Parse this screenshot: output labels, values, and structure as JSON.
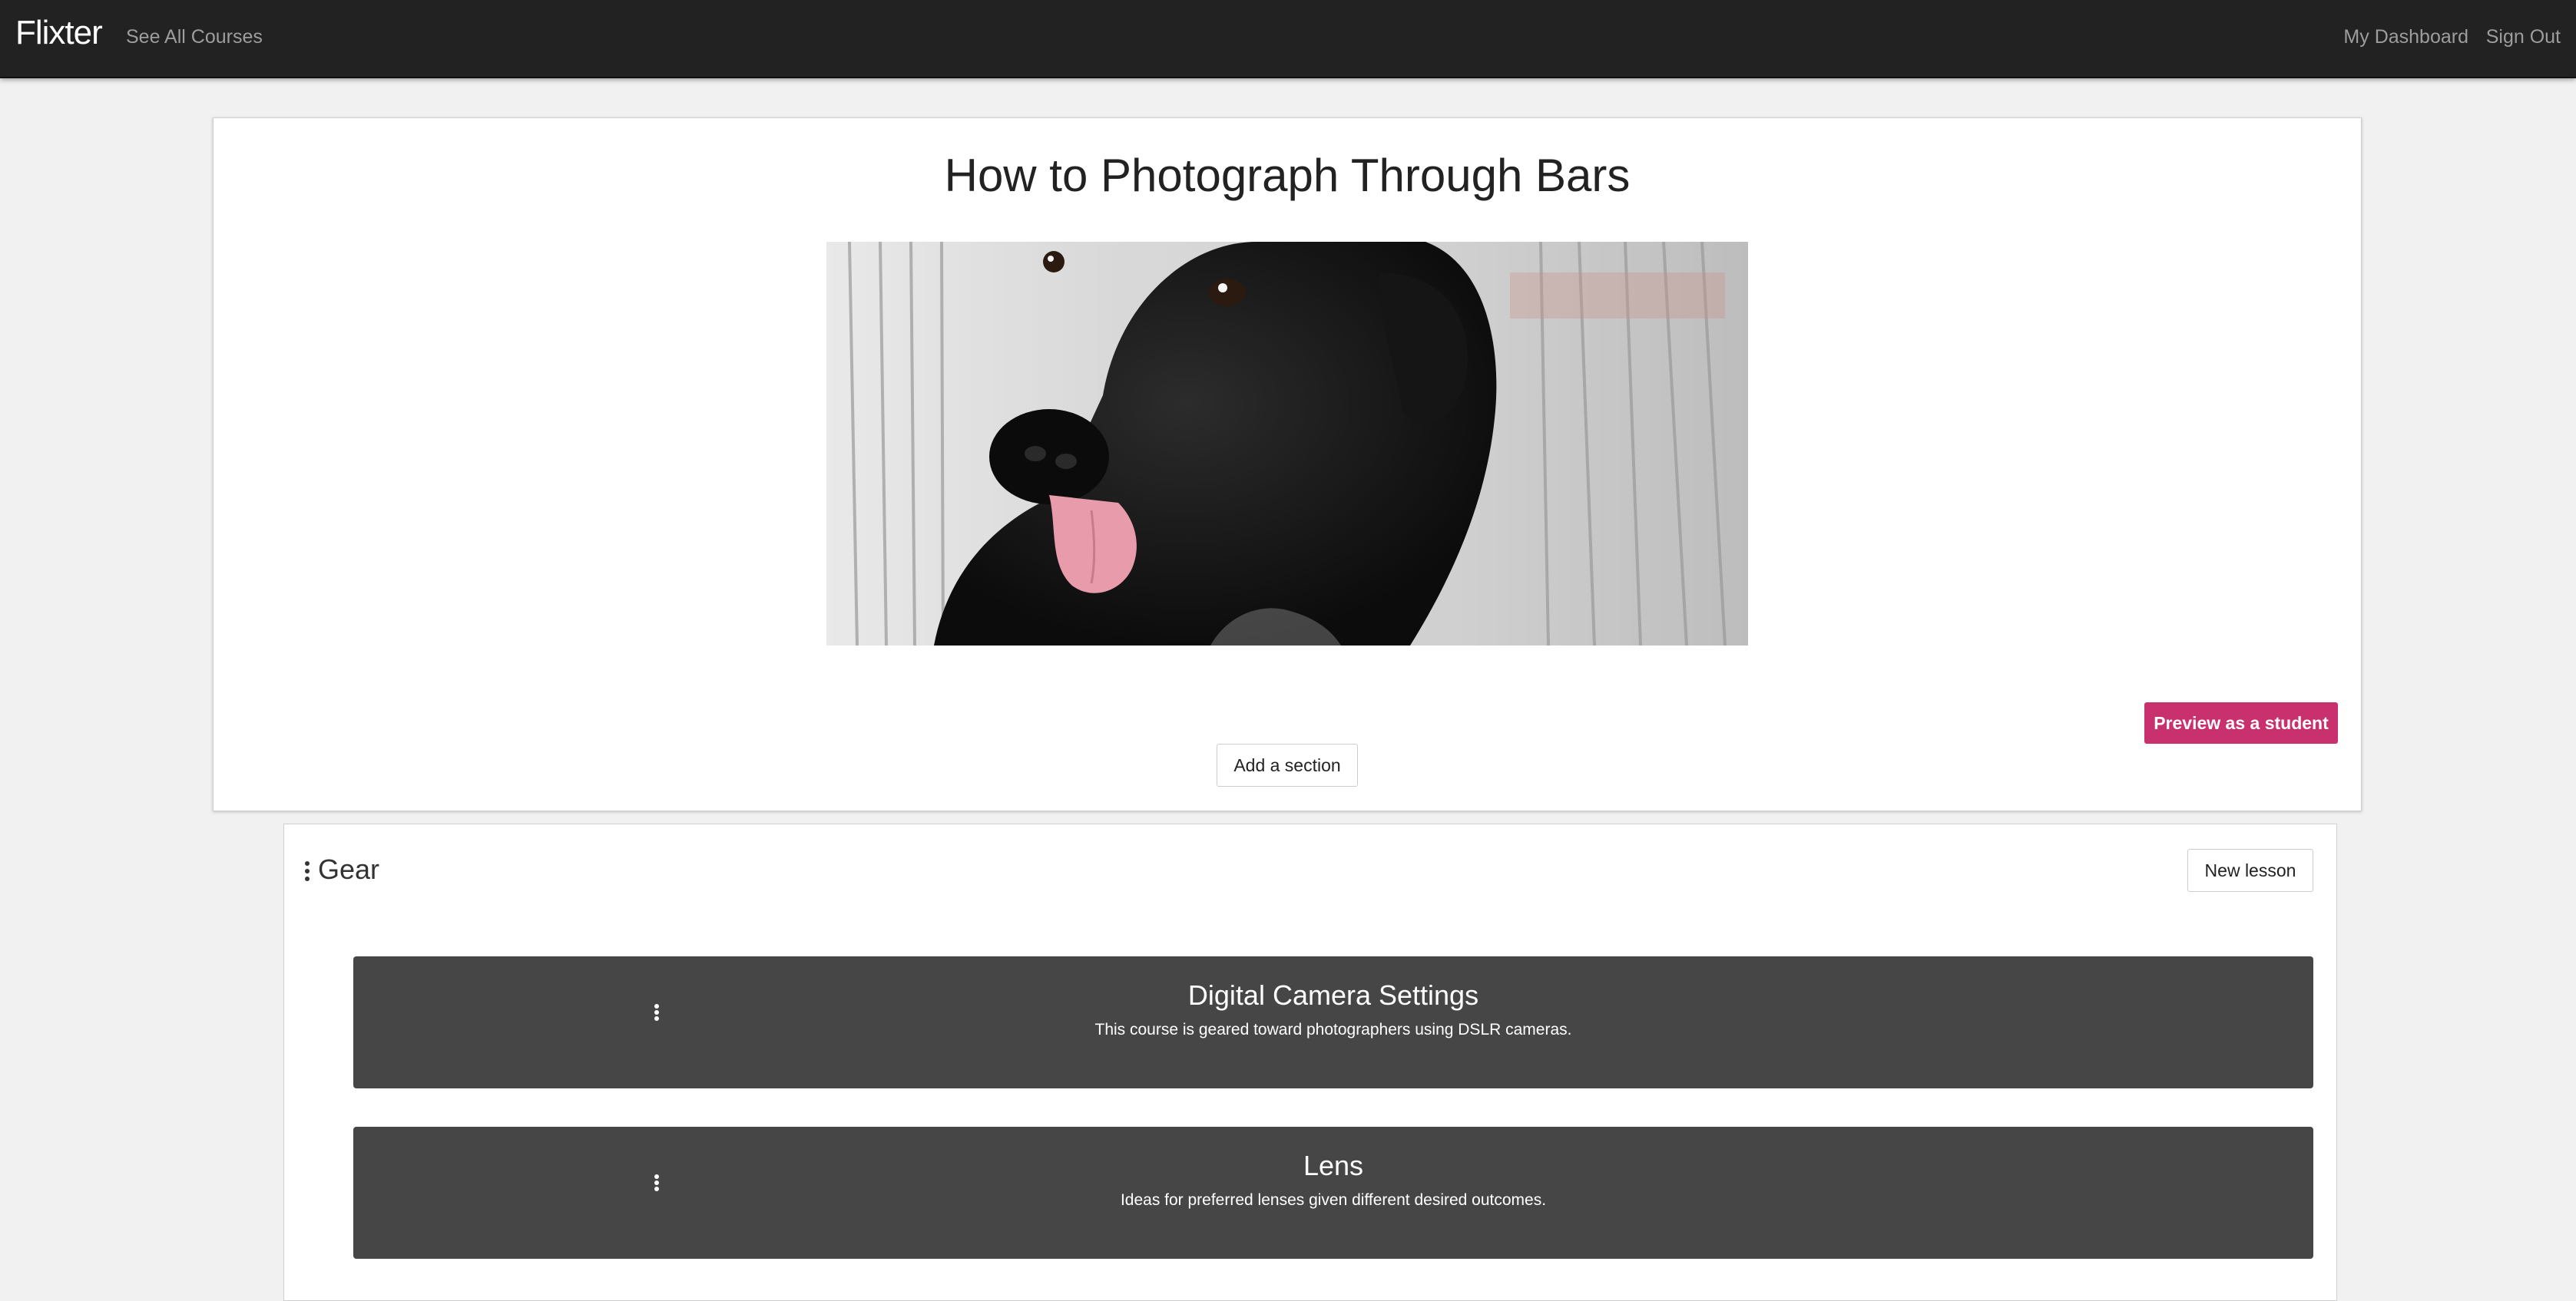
{
  "navbar": {
    "brand": "Flixter",
    "see_all_courses": "See All Courses",
    "my_dashboard": "My Dashboard",
    "sign_out": "Sign Out"
  },
  "course": {
    "title": "How to Photograph Through Bars",
    "image_alt_icon": "dog-photo",
    "preview_button": "Preview as a student",
    "add_section_button": "Add a section"
  },
  "section": {
    "handle_icon": "drag-handle-icon",
    "title": "Gear",
    "new_lesson_button": "New lesson",
    "lessons": [
      {
        "title": "Digital Camera Settings",
        "description": "This course is geared toward photographers using DSLR cameras."
      },
      {
        "title": "Lens",
        "description": "Ideas for preferred lenses given different desired outcomes."
      }
    ]
  },
  "colors": {
    "navbar_bg": "#222222",
    "accent": "#c9306e",
    "lesson_bg": "#464646",
    "page_bg": "#f1f1f1"
  }
}
